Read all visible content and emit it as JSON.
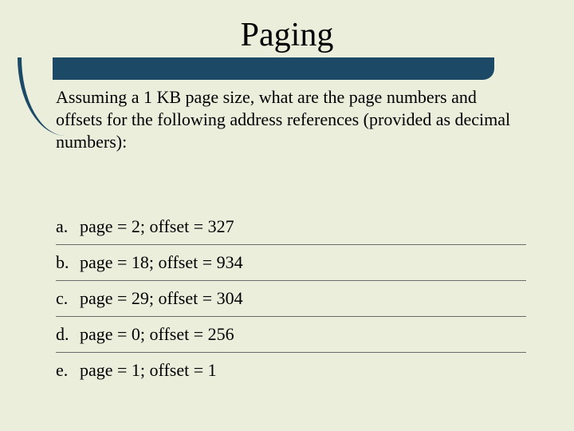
{
  "title": "Paging",
  "intro": "Assuming a 1 KB page size, what are the page numbers and offsets for the following address references (provided as decimal numbers):",
  "items": [
    {
      "marker": "a.",
      "text": "page = 2; offset = 327"
    },
    {
      "marker": "b.",
      "text": "page = 18; offset = 934"
    },
    {
      "marker": "c.",
      "text": "page = 29; offset = 304"
    },
    {
      "marker": "d.",
      "text": "page = 0; offset = 256"
    },
    {
      "marker": "e.",
      "text": "page = 1; offset = 1"
    }
  ]
}
